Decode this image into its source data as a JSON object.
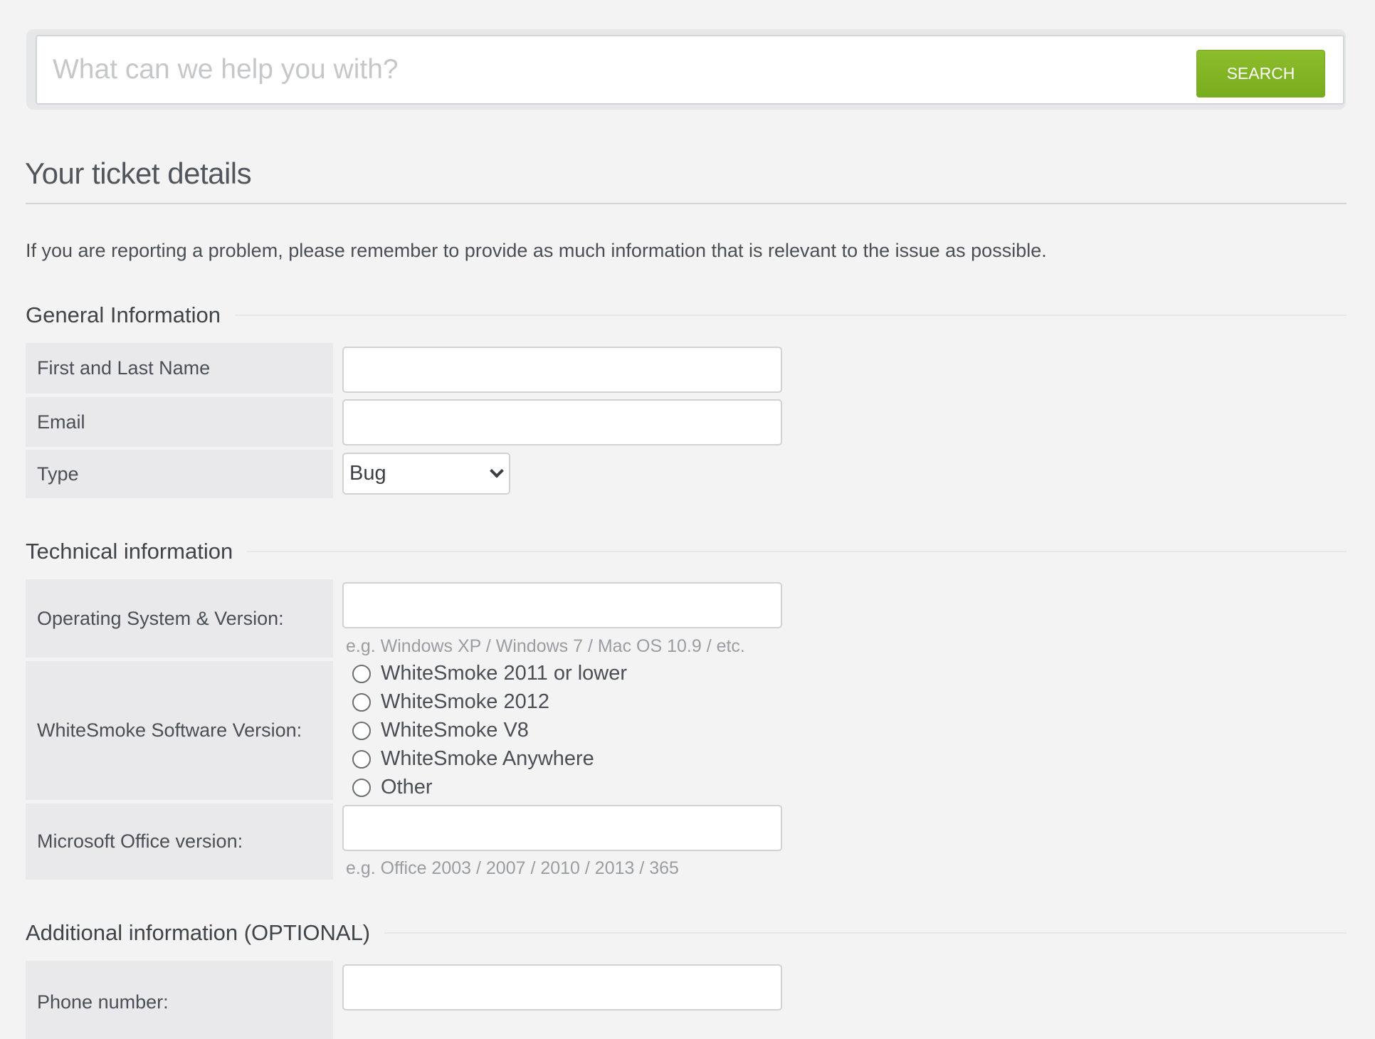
{
  "search": {
    "placeholder": "What can we help you with?",
    "button_label": "SEARCH",
    "button_color": "#80b324"
  },
  "page": {
    "title": "Your ticket details",
    "intro": "If you are reporting a problem, please remember to provide as much information that is relevant to the issue as possible."
  },
  "sections": {
    "general": {
      "title": "General Information",
      "fields": {
        "name": {
          "label": "First and Last Name",
          "value": ""
        },
        "email": {
          "label": "Email",
          "value": ""
        },
        "type": {
          "label": "Type",
          "selected": "Bug"
        }
      }
    },
    "technical": {
      "title": "Technical information",
      "fields": {
        "os": {
          "label": "Operating System & Version:",
          "value": "",
          "hint": "e.g. Windows XP / Windows 7 / Mac OS 10.9 / etc."
        },
        "software": {
          "label": "WhiteSmoke Software Version:",
          "options": [
            "WhiteSmoke 2011 or lower",
            "WhiteSmoke 2012",
            "WhiteSmoke V8",
            "WhiteSmoke Anywhere",
            "Other"
          ],
          "selected": null
        },
        "office": {
          "label": "Microsoft Office version:",
          "value": "",
          "hint": "e.g. Office 2003 / 2007 / 2010 / 2013 / 365"
        }
      }
    },
    "additional": {
      "title": "Additional information (OPTIONAL)",
      "fields": {
        "phone": {
          "label": "Phone number:",
          "value": ""
        }
      }
    }
  }
}
